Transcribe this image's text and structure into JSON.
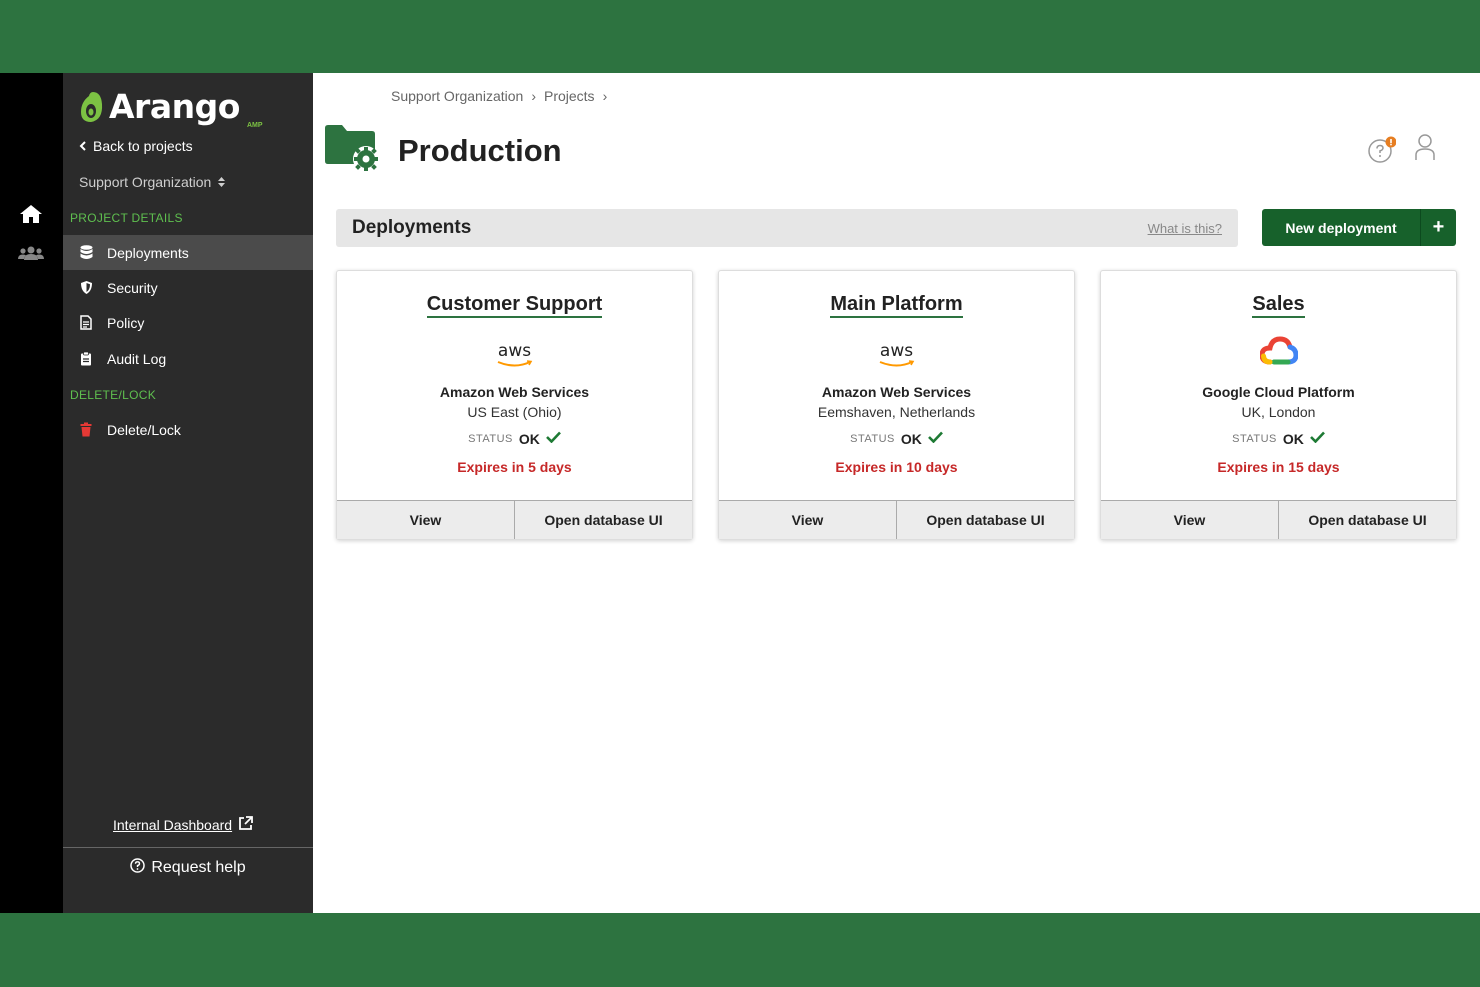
{
  "colors": {
    "brand_green": "#2d7340",
    "accent_light_green": "#5fbf4f",
    "danger": "#c62828",
    "button_dark_green": "#17612b"
  },
  "logo": {
    "name": "Arango",
    "sub": "AMP"
  },
  "sidebar": {
    "back_label": "Back to projects",
    "org_label": "Support Organization",
    "section_project": "PROJECT DETAILS",
    "items": [
      {
        "label": "Deployments",
        "icon": "database-icon"
      },
      {
        "label": "Security",
        "icon": "shield-icon"
      },
      {
        "label": "Policy",
        "icon": "document-icon"
      },
      {
        "label": "Audit Log",
        "icon": "clipboard-icon"
      }
    ],
    "section_delete": "DELETE/LOCK",
    "delete_item": {
      "label": "Delete/Lock",
      "icon": "trash-icon"
    },
    "internal_dashboard": "Internal Dashboard",
    "request_help": "Request help"
  },
  "breadcrumb": {
    "org": "Support Organization",
    "projects": "Projects"
  },
  "page": {
    "title": "Production"
  },
  "deployments_bar": {
    "title": "Deployments",
    "help_link": "What is this?",
    "new_button": "New deployment"
  },
  "cards": [
    {
      "name": "Customer Support",
      "logo": "aws",
      "provider": "Amazon Web Services",
      "region": "US East (Ohio)",
      "status_label": "STATUS",
      "status": "OK",
      "expires": "Expires in 5 days",
      "view": "View",
      "open_db": "Open database UI"
    },
    {
      "name": "Main Platform",
      "logo": "aws",
      "provider": "Amazon Web Services",
      "region": "Eemshaven, Netherlands",
      "status_label": "STATUS",
      "status": "OK",
      "expires": "Expires in 10 days",
      "view": "View",
      "open_db": "Open database UI"
    },
    {
      "name": "Sales",
      "logo": "gcp",
      "provider": "Google Cloud Platform",
      "region": "UK, London",
      "status_label": "STATUS",
      "status": "OK",
      "expires": "Expires in 15 days",
      "view": "View",
      "open_db": "Open database UI"
    }
  ]
}
